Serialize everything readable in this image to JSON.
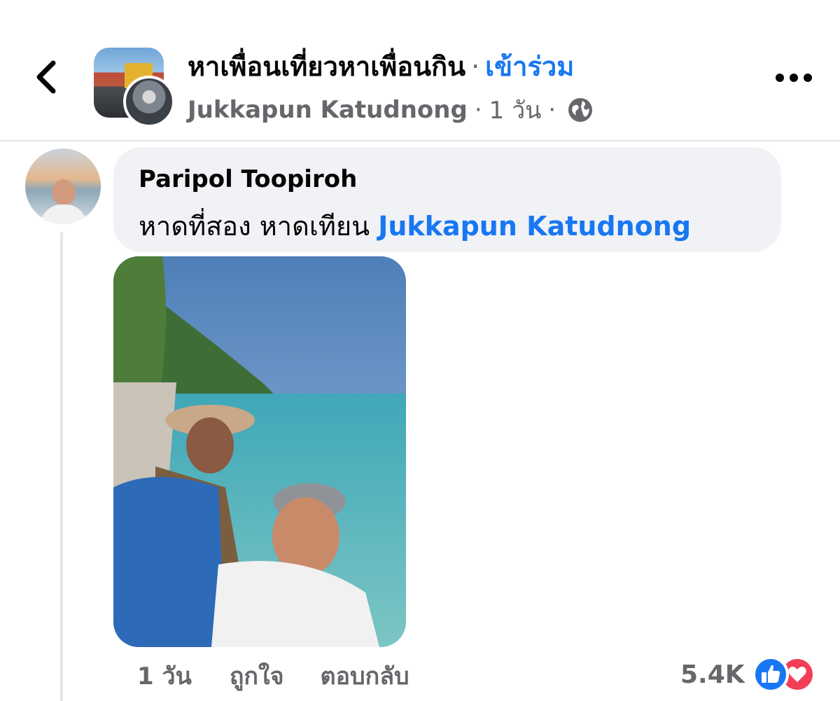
{
  "header": {
    "group_name": "หาเพื่อนเที่ยวหาเพื่อนกิน",
    "separator": "·",
    "join_label": "เข้าร่วม",
    "poster_name": "Jukkapun Katudnong",
    "post_time": "1 วัน",
    "privacy_icon": "globe-icon",
    "back_icon": "chevron-left-icon",
    "more_icon": "more-horizontal-icon"
  },
  "comment": {
    "author": "Paripol Toopiroh",
    "text": "หาดที่สอง หาดเทียน",
    "mention": "Jukkapun Katudnong",
    "time": "1 วัน",
    "like_label": "ถูกใจ",
    "reply_label": "ตอบกลับ",
    "reaction_count": "5.4K",
    "reactions": [
      "like-reaction-icon",
      "love-reaction-icon"
    ]
  },
  "colors": {
    "accent": "#1877f2",
    "secondary_text": "#65676b",
    "bubble": "#f0f2f5",
    "love": "#f33e58"
  }
}
